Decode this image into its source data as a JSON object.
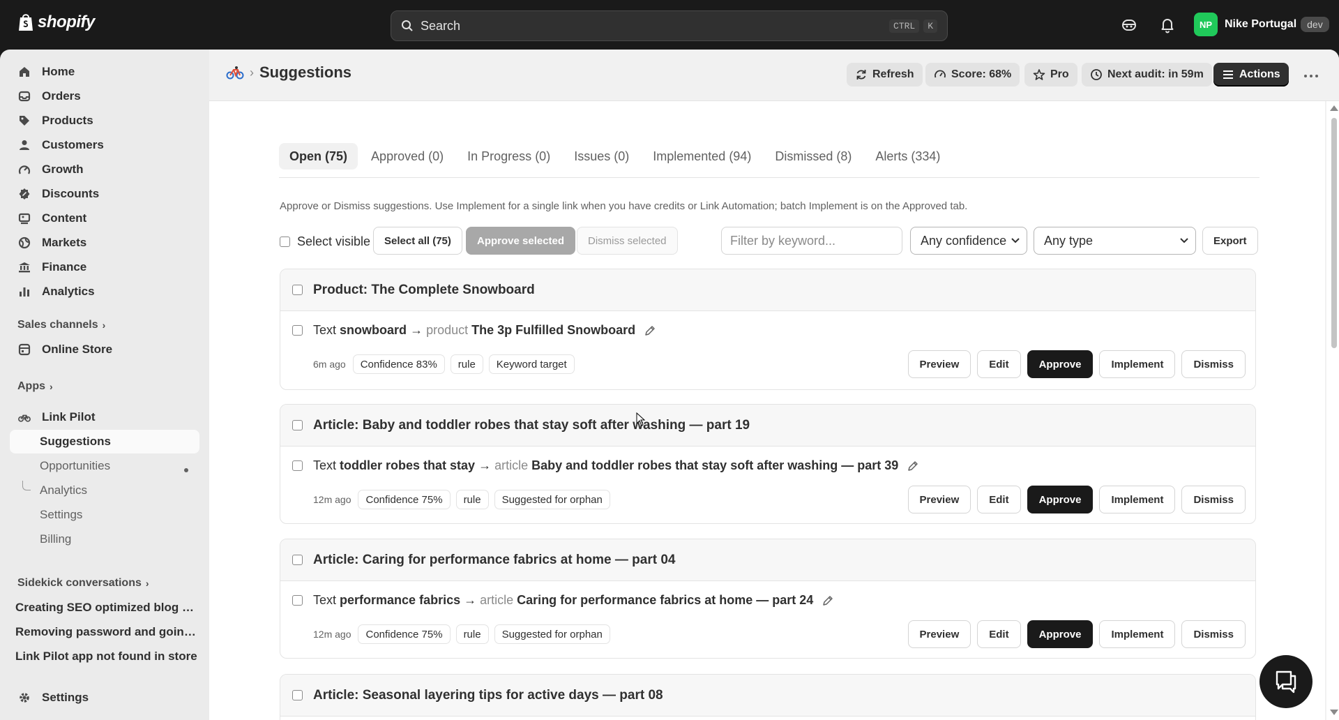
{
  "topbar": {
    "logo_text": "shopify",
    "search_placeholder": "Search",
    "shortcut_key1": "CTRL",
    "shortcut_key2": "K",
    "user_initials": "NP",
    "user_name": "Nike Portugal",
    "user_badge": "dev",
    "avatar_color": "#20c95a"
  },
  "sidebar": {
    "items": [
      {
        "label": "Home",
        "icon": "home-icon"
      },
      {
        "label": "Orders",
        "icon": "orders-icon"
      },
      {
        "label": "Products",
        "icon": "tag-icon"
      },
      {
        "label": "Customers",
        "icon": "person-icon"
      },
      {
        "label": "Growth",
        "icon": "growth-icon"
      },
      {
        "label": "Discounts",
        "icon": "discount-icon"
      },
      {
        "label": "Content",
        "icon": "content-icon"
      },
      {
        "label": "Markets",
        "icon": "globe-icon"
      },
      {
        "label": "Finance",
        "icon": "bank-icon"
      },
      {
        "label": "Analytics",
        "icon": "bar-chart-icon"
      }
    ],
    "sales_channels_label": "Sales channels",
    "online_store_label": "Online Store",
    "apps_label": "Apps",
    "app_name": "Link Pilot",
    "app_subitems": [
      "Suggestions",
      "Opportunities",
      "Analytics",
      "Settings",
      "Billing"
    ],
    "sidekick_label": "Sidekick conversations",
    "conversations": [
      "Creating SEO optimized blog p...",
      "Removing password and going...",
      "Link Pilot app not found in store"
    ],
    "settings_label": "Settings"
  },
  "header": {
    "title": "Suggestions",
    "refresh_label": "Refresh",
    "score_label": "Score: 68%",
    "pro_label": "Pro",
    "next_audit_label": "Next audit: in 59m",
    "actions_label": "Actions"
  },
  "tabs": [
    {
      "name": "Open",
      "count": "(75)"
    },
    {
      "name": "Approved",
      "count": "(0)"
    },
    {
      "name": "In Progress",
      "count": "(0)"
    },
    {
      "name": "Issues",
      "count": "(0)"
    },
    {
      "name": "Implemented",
      "count": "(94)"
    },
    {
      "name": "Dismissed",
      "count": "(8)"
    },
    {
      "name": "Alerts",
      "count": "(334)"
    }
  ],
  "hint": "Approve or Dismiss suggestions. Use Implement for a single link when you have credits or Link Automation; batch Implement is on the Approved tab.",
  "toolbar": {
    "select_visible": "Select visible",
    "select_all": "Select all (75)",
    "approve_selected": "Approve selected",
    "dismiss_selected": "Dismiss selected",
    "filter_placeholder": "Filter by keyword...",
    "confidence_select": "Any confidence",
    "type_select": "Any type",
    "export": "Export"
  },
  "actions": {
    "preview": "Preview",
    "edit": "Edit",
    "approve": "Approve",
    "implement": "Implement",
    "dismiss": "Dismiss"
  },
  "suggestions": [
    {
      "title": "Product: The Complete Snowboard",
      "prefix": "Text",
      "anchor": "snowboard",
      "arrow": "→",
      "target_type": "product",
      "target": "The 3p Fulfilled Snowboard",
      "age": "6m ago",
      "confidence": "Confidence 83%",
      "method": "rule",
      "reason": "Keyword target"
    },
    {
      "title": "Article: Baby and toddler robes that stay soft after washing — part 19",
      "prefix": "Text",
      "anchor": "toddler robes that stay",
      "arrow": "→",
      "target_type": "article",
      "target": "Baby and toddler robes that stay soft after washing — part 39",
      "age": "12m ago",
      "confidence": "Confidence 75%",
      "method": "rule",
      "reason": "Suggested for orphan"
    },
    {
      "title": "Article: Caring for performance fabrics at home — part 04",
      "prefix": "Text",
      "anchor": "performance fabrics",
      "arrow": "→",
      "target_type": "article",
      "target": "Caring for performance fabrics at home — part 24",
      "age": "12m ago",
      "confidence": "Confidence 75%",
      "method": "rule",
      "reason": "Suggested for orphan"
    },
    {
      "title": "Article: Seasonal layering tips for active days — part 08"
    }
  ]
}
